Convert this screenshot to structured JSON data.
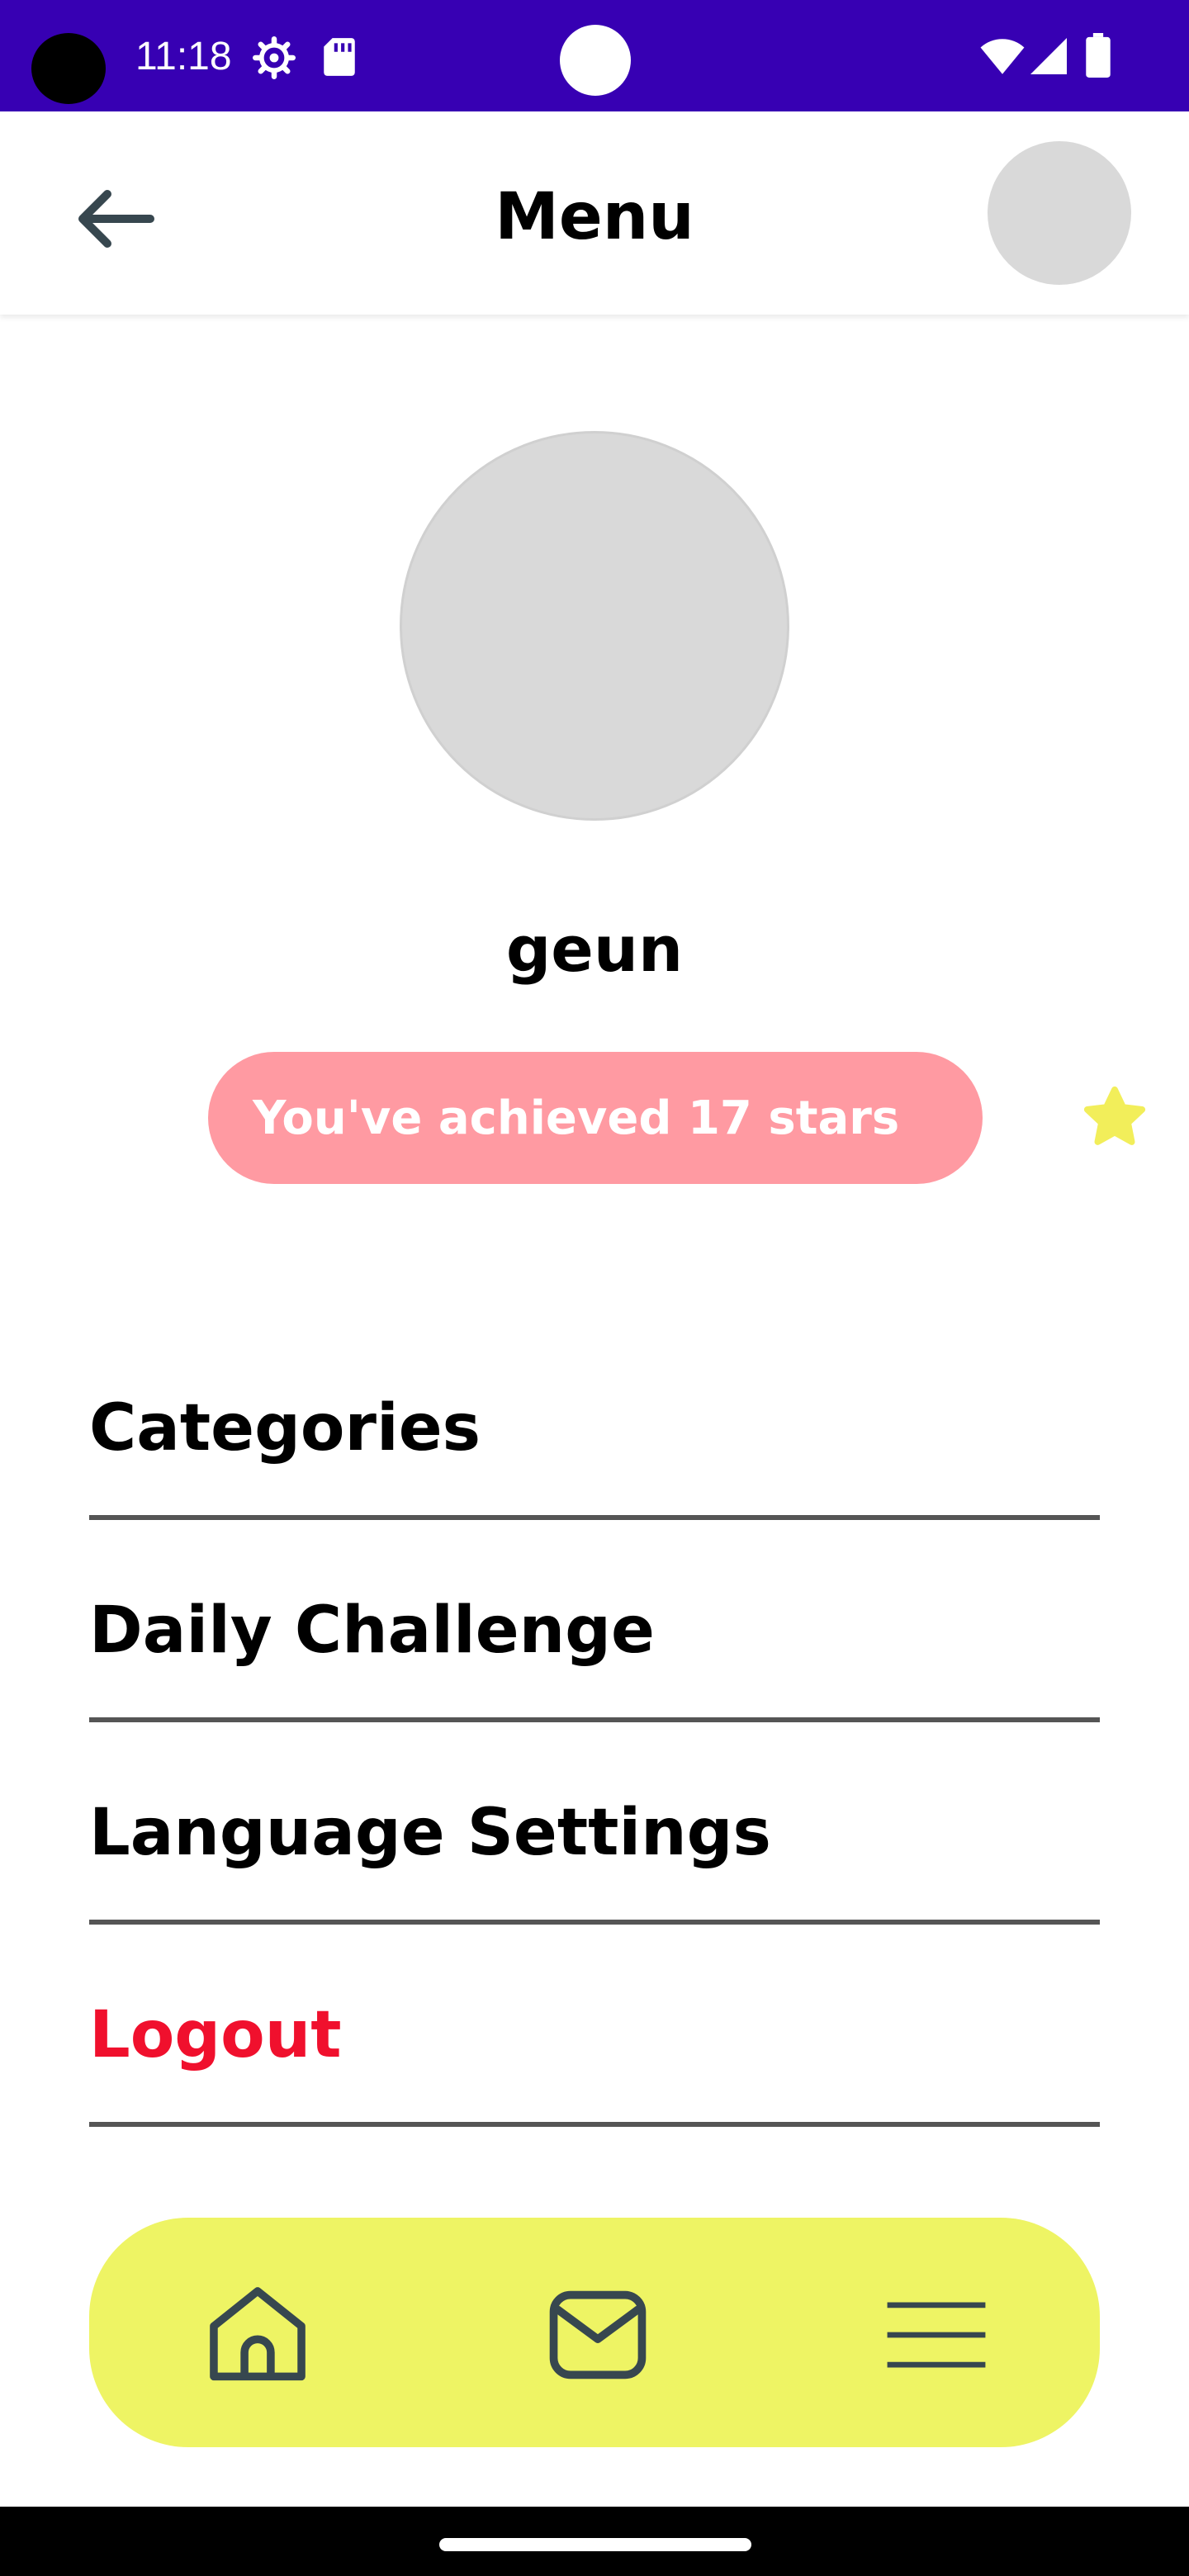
{
  "status_bar": {
    "time": "11:18",
    "background_color": "#3700b3"
  },
  "app_bar": {
    "title": "Menu",
    "back_icon": "arrow-left-icon"
  },
  "profile": {
    "username": "geun",
    "stars_text": "You've achieved 17 stars",
    "badge_color": "#ff9aa2",
    "star_color": "#f2ee5a"
  },
  "menu": {
    "items": [
      {
        "label": "Categories"
      },
      {
        "label": "Daily Challenge"
      },
      {
        "label": "Language Settings"
      },
      {
        "label": "Logout",
        "color": "#f0102d"
      }
    ]
  },
  "bottom_nav": {
    "background_color": "#eef464",
    "items": [
      {
        "icon": "home-icon"
      },
      {
        "icon": "mail-icon"
      },
      {
        "icon": "hamburger-menu-icon"
      }
    ]
  }
}
